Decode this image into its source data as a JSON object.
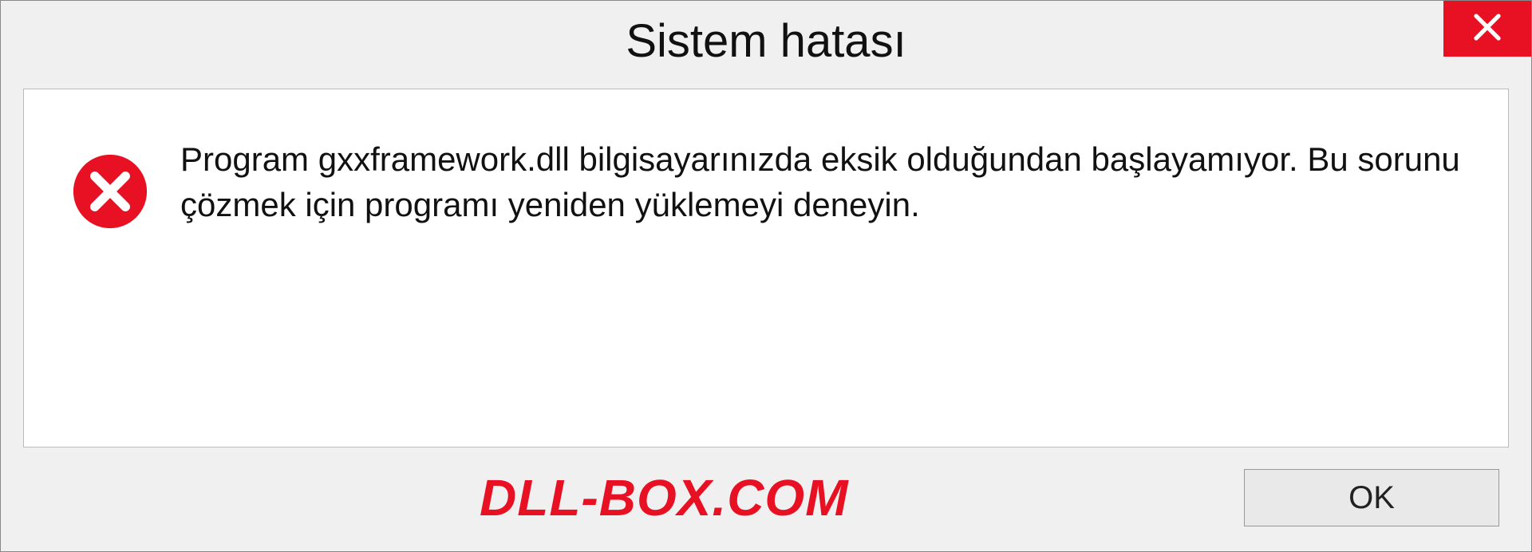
{
  "dialog": {
    "title": "Sistem hatası",
    "message": "Program gxxframework.dll bilgisayarınızda eksik olduğundan başlayamıyor. Bu sorunu çözmek için programı yeniden yüklemeyi deneyin.",
    "ok_label": "OK"
  },
  "watermark": {
    "text": "DLL-BOX.COM"
  }
}
